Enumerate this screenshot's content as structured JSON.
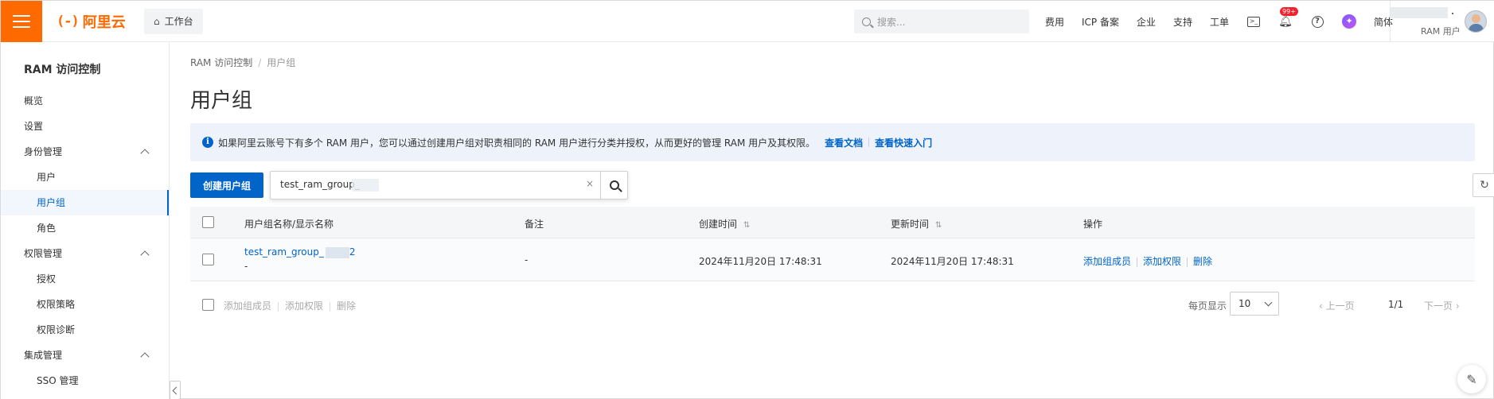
{
  "header": {
    "logo_text": "阿里云",
    "logo_mark": "(-)",
    "workbench_label": "工作台",
    "search_placeholder": "搜索...",
    "links": [
      "费用",
      "ICP 备案",
      "企业",
      "支持",
      "工单"
    ],
    "notification_badge": "99+",
    "lang_label": "简体",
    "user_role": "RAM 用户"
  },
  "sidebar": {
    "title": "RAM 访问控制",
    "items": [
      {
        "label": "概览"
      },
      {
        "label": "设置"
      },
      {
        "label": "身份管理"
      },
      {
        "label": "用户"
      },
      {
        "label": "用户组"
      },
      {
        "label": "角色"
      },
      {
        "label": "权限管理"
      },
      {
        "label": "授权"
      },
      {
        "label": "权限策略"
      },
      {
        "label": "权限诊断"
      },
      {
        "label": "集成管理"
      },
      {
        "label": "SSO 管理"
      }
    ]
  },
  "main": {
    "breadcrumb": [
      "RAM 访问控制",
      "用户组"
    ],
    "title": "用户组",
    "notice": {
      "text": "如果阿里云账号下有多个 RAM 用户，您可以通过创建用户组对职责相同的 RAM 用户进行分类并授权，从而更好的管理 RAM 用户及其权限。",
      "link1": "查看文档",
      "link2": "查看快速入门"
    },
    "create_button": "创建用户组",
    "search_value": "test_ram_group_",
    "table": {
      "headers": [
        "用户组名称/显示名称",
        "备注",
        "创建时间",
        "更新时间",
        "操作"
      ],
      "rows": [
        {
          "name": "test_ram_group_",
          "name_suffix": "2",
          "display_name": "-",
          "remark": "-",
          "created": "2024年11月20日 17:48:31",
          "updated": "2024年11月20日 17:48:31",
          "actions": [
            "添加组成员",
            "添加权限",
            "删除"
          ]
        }
      ]
    },
    "bulk_actions": [
      "添加组成员",
      "添加权限",
      "删除"
    ],
    "pagination": {
      "per_page_label": "每页显示",
      "per_page": "10",
      "prev": "上一页",
      "current": "1/1",
      "next": "下一页"
    }
  },
  "colors": {
    "brand": "#ff6a00",
    "primary": "#0064c8"
  }
}
